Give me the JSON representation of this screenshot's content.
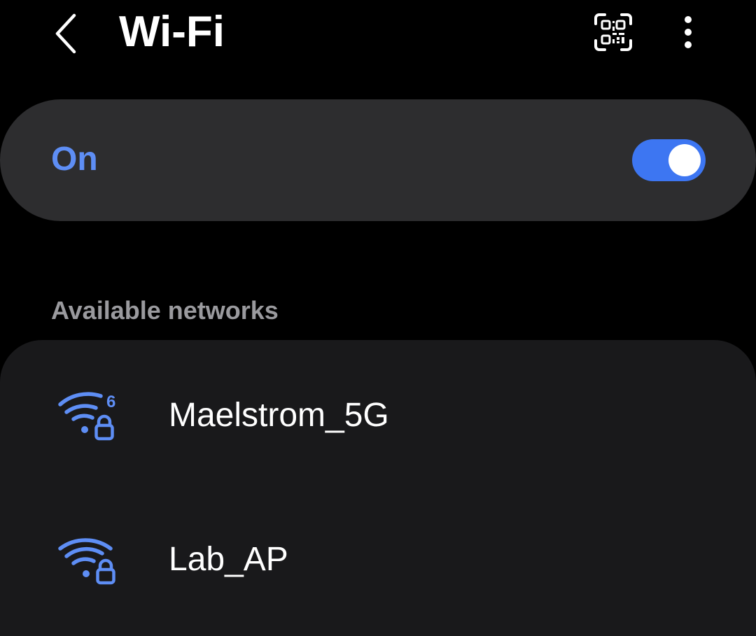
{
  "header": {
    "title": "Wi-Fi",
    "back_icon": "chevron-left-icon",
    "qr_icon": "qr-code-scan-icon",
    "more_icon": "more-vertical-icon"
  },
  "wifi_toggle": {
    "label": "On",
    "enabled": true,
    "accent_color": "#3d76f2",
    "label_color": "#5e8ef5"
  },
  "networks": {
    "section_title": "Available networks",
    "items": [
      {
        "name": "Maelstrom_5G",
        "icon": "wifi-6-locked-icon",
        "badge": "6",
        "secured": true
      },
      {
        "name": "Lab_AP",
        "icon": "wifi-locked-icon",
        "secured": true
      }
    ]
  }
}
